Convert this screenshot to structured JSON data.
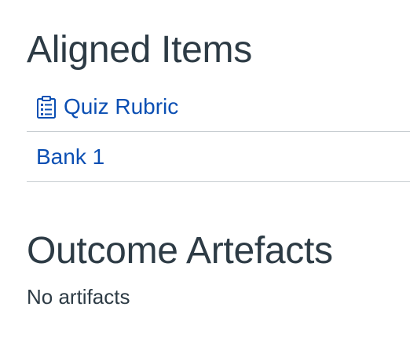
{
  "aligned_items": {
    "heading": "Aligned Items",
    "items": [
      {
        "label": "Quiz Rubric",
        "icon": "quiz-icon"
      },
      {
        "label": "Bank 1"
      }
    ]
  },
  "outcome_artefacts": {
    "heading": "Outcome Artefacts",
    "empty_text": "No artifacts"
  },
  "colors": {
    "text": "#2d3b45",
    "link": "#0b4fb3",
    "divider": "#c7cdd1"
  }
}
